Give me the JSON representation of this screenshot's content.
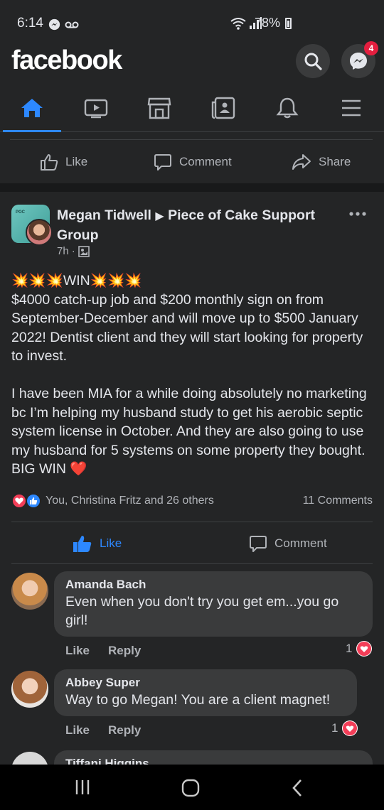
{
  "status": {
    "time": "6:14",
    "battery": "78%"
  },
  "header": {
    "logo": "facebook",
    "messenger_badge": "4"
  },
  "nav": {
    "items": [
      "home",
      "watch",
      "marketplace",
      "news",
      "notifications",
      "menu"
    ],
    "active": "home"
  },
  "prev_post_actions": {
    "like": "Like",
    "comment": "Comment",
    "share": "Share"
  },
  "post": {
    "author": "Megan Tidwell",
    "arrow": "▶",
    "group": "Piece of Cake Support Group",
    "time": "7h",
    "body": "💥💥💥WIN💥💥💥\n$4000 catch-up job and $200 monthly sign on from September-December and will move up to $500 January 2022! Dentist client and they will start looking for property to invest.\n\nI have been MIA for a while doing absolutely no marketing bc I’m helping my husband study to get his aerobic septic system license in October. And they are also going to use my husband for 5 systems on some property they bought. BIG WIN ❤️",
    "reactions_text": "You, Christina Fritz and 26 others",
    "comments_count": "11 Comments",
    "like_label": "Like",
    "comment_label": "Comment"
  },
  "comments": [
    {
      "name": "Amanda Bach",
      "text": "Even when you don't try you get em...you go girl!",
      "like": "Like",
      "reply": "Reply",
      "reactions": "1"
    },
    {
      "name": "Abbey Super",
      "text": "Way to go Megan! You are a client magnet!",
      "like": "Like",
      "reply": "Reply",
      "reactions": "1"
    },
    {
      "name": "Tiffani Higgins",
      "text": ""
    }
  ],
  "colors": {
    "accent": "#2d88ff",
    "background": "#242526",
    "bubble": "#3a3b3c",
    "heart": "#f33e58"
  }
}
